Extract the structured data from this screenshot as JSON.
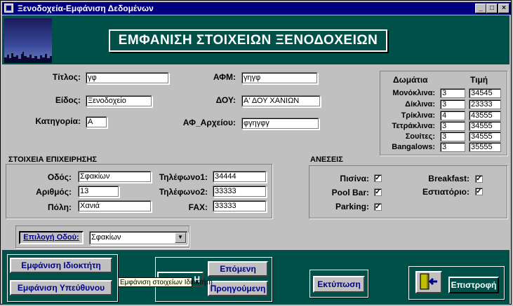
{
  "window": {
    "title": "Ξενοδοχεία-Εμφάνιση Δεδομένων",
    "minimize": "_",
    "maximize": "□",
    "close": "×"
  },
  "header": {
    "title": "ΕΜΦΑΝΙΣΗ ΣΤΟΙΧΕΙΩΝ ΞΕΝΟΔΟΧΕΙΩΝ"
  },
  "fields": {
    "titlos_label": "Τίτλος:",
    "titlos": "γφ",
    "eidos_label": "Είδος:",
    "eidos": "Ξενοδοχείο",
    "kategoria_label": "Κατηγορία:",
    "kategoria": "Α",
    "afm_label": "ΑΦΜ:",
    "afm": "γηγφ",
    "doy_label": "ΔΟΥ:",
    "doy": "Α' ΔΟΥ ΧΑΝΙΩΝ",
    "af_arxeiou_label": "ΑΦ_Αρχείου:",
    "af_arxeiou": "φγηγφγ"
  },
  "rooms": {
    "col_rooms": "Δωμάτια",
    "col_price": "Τιμή",
    "rows": [
      {
        "label": "Μονόκλινα:",
        "count": "3",
        "price": "34545"
      },
      {
        "label": "Δίκλινα:",
        "count": "3",
        "price": "23333"
      },
      {
        "label": "Τρίκλινα:",
        "count": "4",
        "price": "43555"
      },
      {
        "label": "Τετράκλινα:",
        "count": "3",
        "price": "34555"
      },
      {
        "label": "Σουίτες:",
        "count": "3",
        "price": "34555"
      },
      {
        "label": "Bangalows:",
        "count": "3",
        "price": "35555"
      }
    ]
  },
  "business": {
    "title": "ΣΤΟΙΧΕΙΑ ΕΠΙΧΕΙΡΗΣΗΣ",
    "odos_label": "Οδός:",
    "odos": "Σφακίων",
    "arithmos_label": "Αριθμός:",
    "arithmos": "13",
    "poli_label": "Πόλη:",
    "poli": "Χανιά",
    "tel1_label": "Τηλέφωνο1:",
    "tel1": "34444",
    "tel2_label": "Τηλέφωνο2:",
    "tel2": "33333",
    "fax_label": "FAX:",
    "fax": "33333"
  },
  "amenities": {
    "title": "ΑΝΕΣΕΙΣ",
    "pisina_label": "Πισίνα:",
    "poolbar_label": "Pool Bar:",
    "parking_label": "Parking:",
    "breakfast_label": "Breakfast:",
    "estiatorio_label": "Εστιατόριο:",
    "check_mark": "✓"
  },
  "street_select": {
    "button": "Επιλογή Οδού:",
    "value": "Σφακίων",
    "arrow": "▼"
  },
  "buttons": {
    "owner": "Εμφάνιση Ιδιοκτήτη",
    "manager": "Εμφάνιση Υπεύθυνου",
    "next": "Επόμενη",
    "previous": "Προηγούμενη",
    "print": "Εκτύπωση",
    "back": "Επιστροφή",
    "hidden_partial": "Η"
  },
  "tooltip": "Εμφάνιση στοιχείων Ιδιοκτήτη"
}
